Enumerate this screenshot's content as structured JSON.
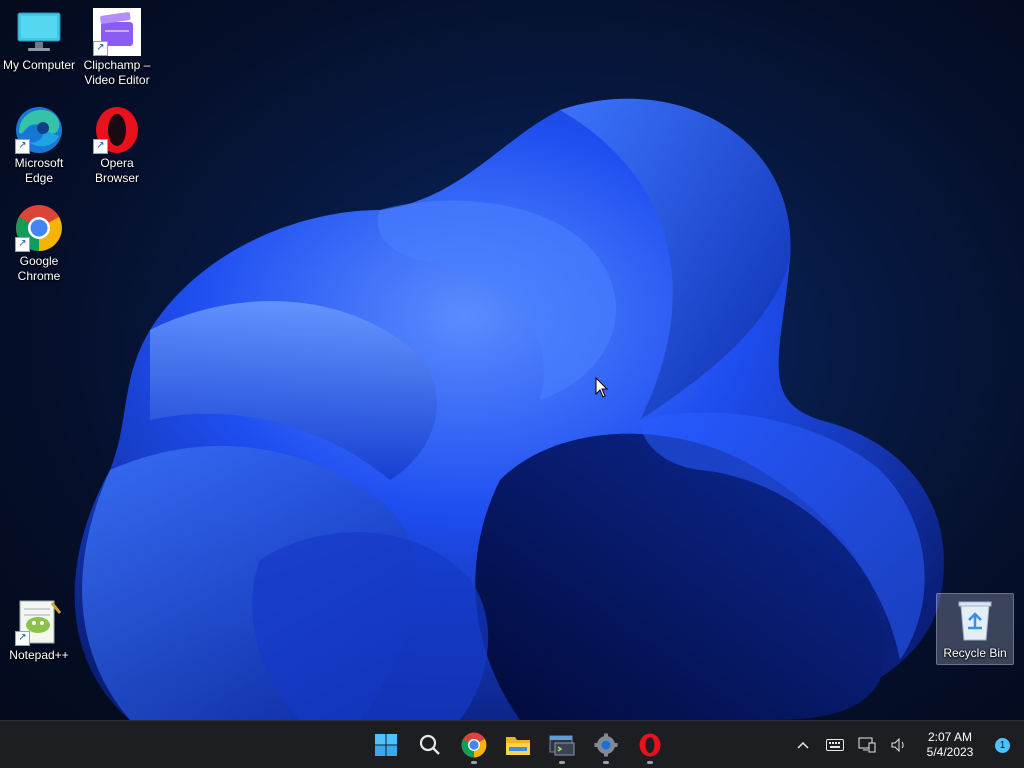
{
  "desktop": {
    "icons": [
      {
        "label": "My Computer",
        "icon": "monitor-icon"
      },
      {
        "label": "Clipchamp –\nVideo Editor",
        "icon": "clipchamp-icon"
      },
      {
        "label": "Microsoft\nEdge",
        "icon": "edge-icon"
      },
      {
        "label": "Opera\nBrowser",
        "icon": "opera-icon"
      },
      {
        "label": "Google\nChrome",
        "icon": "chrome-icon"
      },
      {
        "label": "Notepad++",
        "icon": "notepadpp-icon"
      },
      {
        "label": "Recycle Bin",
        "icon": "recycle-bin-icon"
      }
    ]
  },
  "taskbar": {
    "apps": [
      "start-icon",
      "search-icon",
      "chrome-icon",
      "file-explorer-icon",
      "terminal-icon",
      "settings-icon",
      "opera-icon"
    ],
    "tray": {
      "time": "2:07 AM",
      "date": "5/4/2023",
      "notification_count": "1",
      "icons": [
        "chevron-up-icon",
        "keyboard-icon",
        "network-icon",
        "volume-icon"
      ]
    }
  },
  "colors": {
    "taskbar_bg": "#1c1e22",
    "accent": "#4cc2ff",
    "wallpaper_blue": "#1a4dff"
  }
}
